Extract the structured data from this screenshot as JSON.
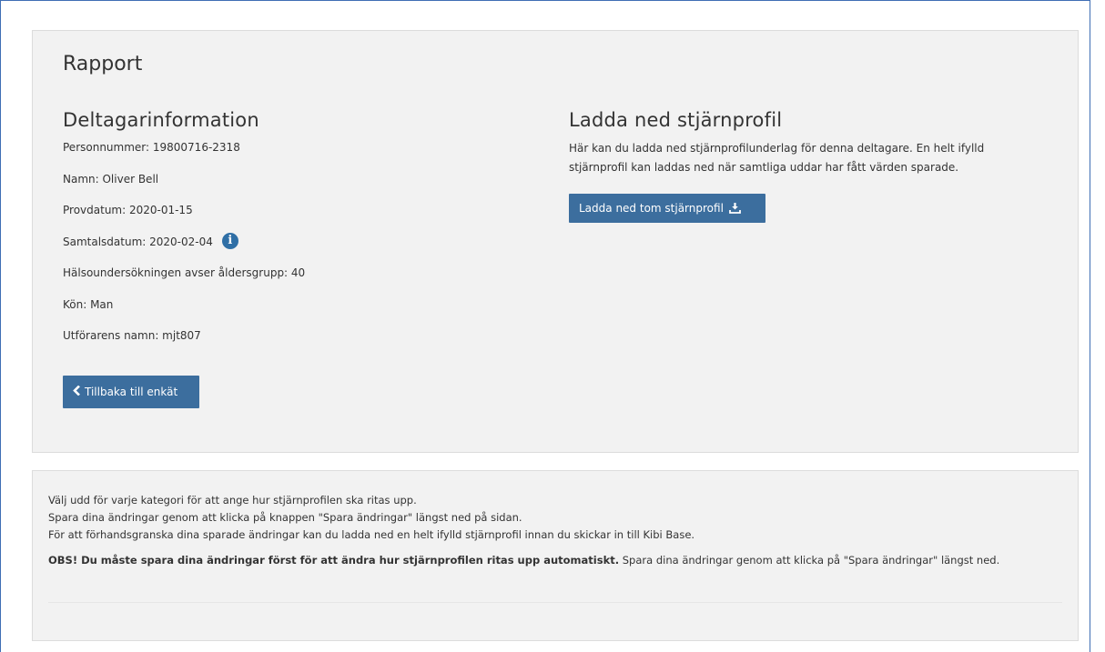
{
  "report": {
    "title": "Rapport"
  },
  "participant": {
    "section_title": "Deltagarinformation",
    "lines": [
      "Personnummer: 19800716-2318",
      "Namn: Oliver Bell",
      "Provdatum: 2020-01-15",
      "Samtalsdatum: 2020-02-04",
      "Hälsoundersökningen avser åldersgrupp: 40",
      "Kön: Man",
      "Utförarens namn: mjt807"
    ],
    "info_icon_glyph": "i",
    "back_button_label": "Tillbaka till enkät"
  },
  "download": {
    "section_title": "Ladda ned stjärnprofil",
    "description_line1": "Här kan du ladda ned stjärnprofilunderlag för denna deltagare. En helt ifylld",
    "description_line2": "stjärnprofil kan laddas ned när samtliga uddar har fått värden sparade.",
    "button_label": "Ladda ned tom stjärnprofil"
  },
  "instructions": {
    "line1": "Välj udd för varje kategori för att ange hur stjärnprofilen ska ritas upp.",
    "line2": "Spara dina ändringar genom att klicka på knappen \"Spara ändringar\" längst ned på sidan.",
    "line3": "För att förhandsgranska dina sparade ändringar kan du ladda ned en helt ifylld stjärnprofil innan du skickar in till Kibi Base.",
    "obs_bold": "OBS! Du måste spara dina ändringar först för att ändra hur stjärnprofilen ritas upp automatiskt.",
    "obs_rest": " Spara dina ändringar genom att klicka på \"Spara ändringar\" längst ned."
  },
  "colors": {
    "button_bg": "#3c6e9e",
    "panel_bg": "#f2f2f2",
    "info_icon": "#2f6fa6"
  }
}
